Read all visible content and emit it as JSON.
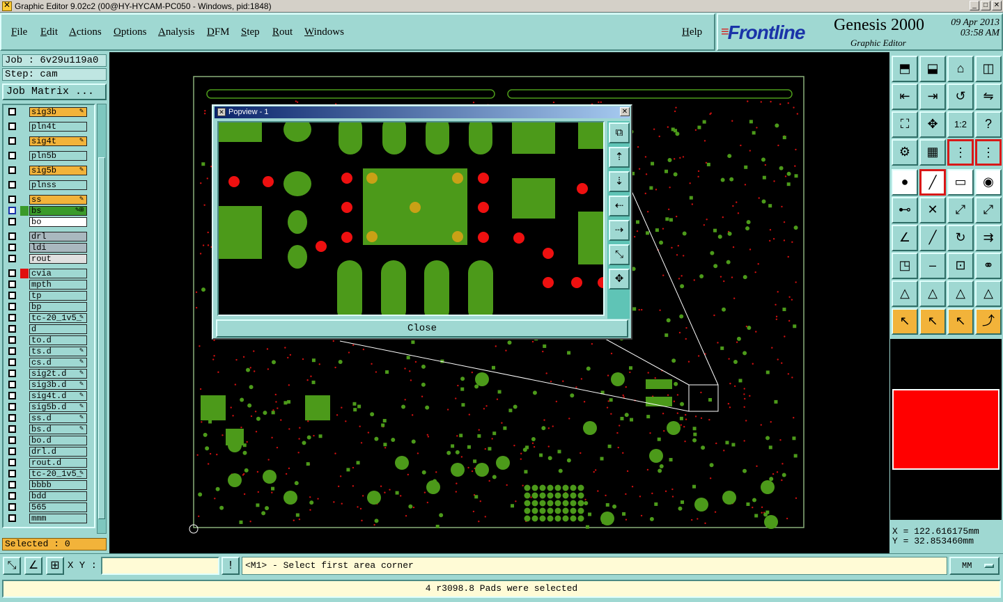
{
  "window": {
    "title": "Graphic Editor 9.02c2 (00@HY-HYCAM-PC050 - Windows, pid:1848)"
  },
  "menu": [
    "File",
    "Edit",
    "Actions",
    "Options",
    "Analysis",
    "DFM",
    "Step",
    "Rout",
    "Windows"
  ],
  "help": "Help",
  "logo": {
    "brand": "Frontline",
    "product": "Genesis 2000",
    "subtitle": "Graphic Editor",
    "date": "09 Apr 2013",
    "time": "03:58 AM"
  },
  "job": {
    "job_label": "Job : 6v29u119a0",
    "step_label": "Step: cam",
    "matrix_button": "Job Matrix ..."
  },
  "layers": [
    {
      "name": "sig3b",
      "color": "#f2b33a",
      "mark": "✎"
    },
    {
      "name": "pln4t",
      "color": "#9fd8d2",
      "mark": ""
    },
    {
      "name": "sig4t",
      "color": "#f2b33a",
      "mark": "✎"
    },
    {
      "name": "pln5b",
      "color": "#9fd8d2",
      "mark": ""
    },
    {
      "name": "sig5b",
      "color": "#f2b33a",
      "mark": "✎"
    },
    {
      "name": "plnss",
      "color": "#9fd8d2",
      "mark": ""
    },
    {
      "name": "ss",
      "color": "#f2b33a",
      "mark": "✎"
    },
    {
      "name": "bs",
      "color": "#3a9a2a",
      "mark": "✎⊞"
    },
    {
      "name": "bo",
      "color": "#ffffff",
      "mark": ""
    },
    {
      "name": "drl",
      "color": "#a9b8bf",
      "mark": ""
    },
    {
      "name": "ldi",
      "color": "#a9b8bf",
      "mark": ""
    },
    {
      "name": "rout",
      "color": "#e0e0e0",
      "mark": ""
    },
    {
      "name": "cvia",
      "color": "#9fd8d2",
      "mark": ""
    },
    {
      "name": "mpth",
      "color": "#9fd8d2",
      "mark": ""
    },
    {
      "name": "tp",
      "color": "#9fd8d2",
      "mark": ""
    },
    {
      "name": "bp",
      "color": "#9fd8d2",
      "mark": ""
    },
    {
      "name": "tc-20_1v5_",
      "color": "#9fd8d2",
      "mark": "✎"
    },
    {
      "name": "d",
      "color": "#9fd8d2",
      "mark": ""
    },
    {
      "name": "to.d",
      "color": "#9fd8d2",
      "mark": ""
    },
    {
      "name": "ts.d",
      "color": "#9fd8d2",
      "mark": "✎"
    },
    {
      "name": "cs.d",
      "color": "#9fd8d2",
      "mark": "✎"
    },
    {
      "name": "sig2t.d",
      "color": "#9fd8d2",
      "mark": "✎"
    },
    {
      "name": "sig3b.d",
      "color": "#9fd8d2",
      "mark": "✎"
    },
    {
      "name": "sig4t.d",
      "color": "#9fd8d2",
      "mark": "✎"
    },
    {
      "name": "sig5b.d",
      "color": "#9fd8d2",
      "mark": "✎"
    },
    {
      "name": "ss.d",
      "color": "#9fd8d2",
      "mark": "✎"
    },
    {
      "name": "bs.d",
      "color": "#9fd8d2",
      "mark": "✎"
    },
    {
      "name": "bo.d",
      "color": "#9fd8d2",
      "mark": ""
    },
    {
      "name": "drl.d",
      "color": "#9fd8d2",
      "mark": ""
    },
    {
      "name": "rout.d",
      "color": "#9fd8d2",
      "mark": ""
    },
    {
      "name": "tc-20_1v5_",
      "color": "#9fd8d2",
      "mark": "✎"
    },
    {
      "name": "bbbb",
      "color": "#9fd8d2",
      "mark": ""
    },
    {
      "name": "bdd",
      "color": "#9fd8d2",
      "mark": ""
    },
    {
      "name": "565",
      "color": "#9fd8d2",
      "mark": ""
    },
    {
      "name": "mmm",
      "color": "#9fd8d2",
      "mark": ""
    }
  ],
  "selected": "Selected : 0",
  "popview": {
    "title": "Popview - 1",
    "close_button": "Close"
  },
  "coords": {
    "x": "X = 122.616175mm",
    "y": "Y = 32.853460mm"
  },
  "bottom": {
    "xy_label": "X Y :",
    "xy_value": "",
    "prompt": "<M1> - Select first area corner",
    "units": "MM"
  },
  "status": "4 r3098.8 Pads were selected",
  "colors": {
    "panel": "#9fd8d2",
    "board_green": "#4c9a1a",
    "pad_red": "#e01010",
    "highlight": "#f2b33a"
  }
}
